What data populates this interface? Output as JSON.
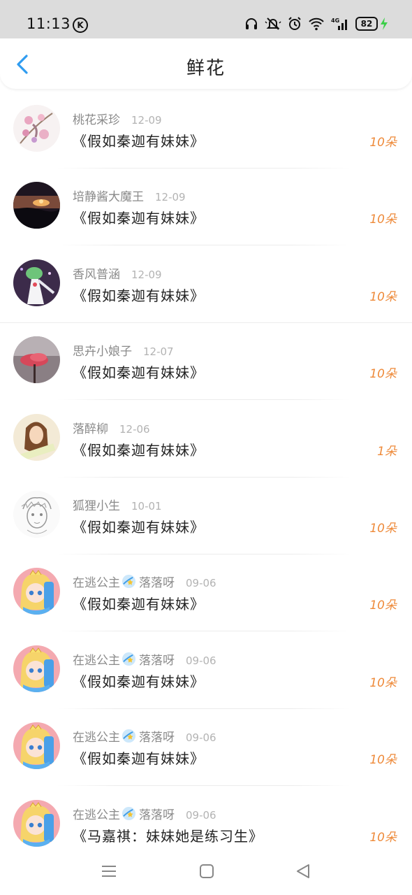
{
  "status_bar": {
    "time": "11:13",
    "carrier_badge": "K",
    "battery": "82",
    "network": "4G"
  },
  "header": {
    "title": "鲜花"
  },
  "accent_color": "#ee8a3a",
  "rows": [
    {
      "name": "桃花采珍",
      "date": "12-09",
      "title": "《假如秦迦有妹妹》",
      "amount": "10朵",
      "avatar": "peach-blossom-avatar"
    },
    {
      "name": "培静酱大魔王",
      "date": "12-09",
      "title": "《假如秦迦有妹妹》",
      "amount": "10朵",
      "avatar": "sunset-avatar"
    },
    {
      "name": "香风普涵",
      "date": "12-09",
      "title": "《假如秦迦有妹妹》",
      "amount": "10朵",
      "avatar": "gardevoir-avatar"
    },
    {
      "name": "思卉小娘子",
      "date": "12-07",
      "title": "《假如秦迦有妹妹》",
      "amount": "10朵",
      "avatar": "pink-flower-avatar"
    },
    {
      "name": "落醉柳",
      "date": "12-06",
      "title": "《假如秦迦有妹妹》",
      "amount": "1朵",
      "avatar": "girl-avatar"
    },
    {
      "name": "狐狸小生",
      "date": "10-01",
      "title": "《假如秦迦有妹妹》",
      "amount": "10朵",
      "avatar": "sketch-avatar"
    },
    {
      "name_before": "在逃公主",
      "name_after": "落落呀",
      "date": "09-06",
      "title": "《假如秦迦有妹妹》",
      "amount": "10朵",
      "avatar": "princess-avatar"
    },
    {
      "name_before": "在逃公主",
      "name_after": "落落呀",
      "date": "09-06",
      "title": "《假如秦迦有妹妹》",
      "amount": "10朵",
      "avatar": "princess-avatar"
    },
    {
      "name_before": "在逃公主",
      "name_after": "落落呀",
      "date": "09-06",
      "title": "《假如秦迦有妹妹》",
      "amount": "10朵",
      "avatar": "princess-avatar"
    },
    {
      "name_before": "在逃公主",
      "name_after": "落落呀",
      "date": "09-06",
      "title": "《马嘉祺：妹妹她是练习生》",
      "amount": "10朵",
      "avatar": "princess-avatar"
    }
  ]
}
